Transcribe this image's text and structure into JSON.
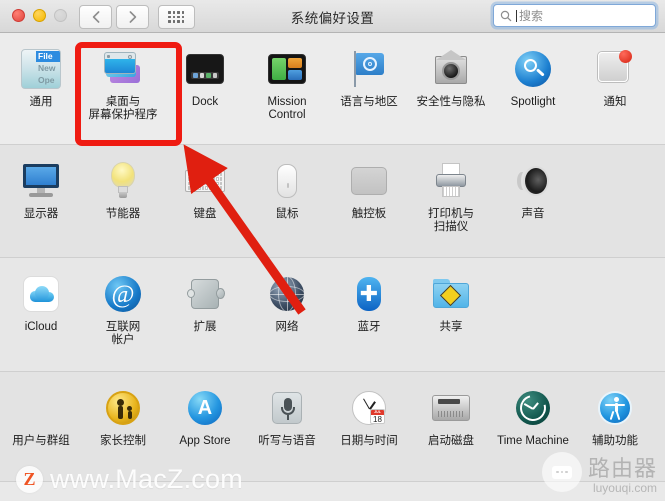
{
  "window": {
    "title": "系统偏好设置",
    "traffic_lights": [
      "close",
      "minimize",
      "zoom"
    ],
    "nav": {
      "back_label": "‹",
      "forward_label": "›",
      "grid_label": "show-all"
    },
    "search": {
      "placeholder": "搜索",
      "value": "",
      "icon": "search-icon"
    }
  },
  "rows": [
    {
      "id": "row-personal",
      "items": [
        {
          "label": "通用",
          "icon": "general-icon"
        },
        {
          "label": "桌面与\n屏幕保护程序",
          "icon": "desktop-screensaver-icon",
          "highlighted": true
        },
        {
          "label": "Dock",
          "icon": "dock-icon"
        },
        {
          "label": "Mission\nControl",
          "icon": "mission-control-icon"
        },
        {
          "label": "语言与地区",
          "icon": "language-region-icon"
        },
        {
          "label": "安全性与隐私",
          "icon": "security-privacy-icon"
        },
        {
          "label": "Spotlight",
          "icon": "spotlight-icon"
        },
        {
          "label": "通知",
          "icon": "notifications-icon"
        }
      ]
    },
    {
      "id": "row-hardware",
      "items": [
        {
          "label": "显示器",
          "icon": "displays-icon"
        },
        {
          "label": "节能器",
          "icon": "energy-saver-icon"
        },
        {
          "label": "键盘",
          "icon": "keyboard-icon"
        },
        {
          "label": "鼠标",
          "icon": "mouse-icon"
        },
        {
          "label": "触控板",
          "icon": "trackpad-icon"
        },
        {
          "label": "打印机与\n扫描仪",
          "icon": "printers-scanners-icon"
        },
        {
          "label": "声音",
          "icon": "sound-icon"
        }
      ]
    },
    {
      "id": "row-internet",
      "items": [
        {
          "label": "iCloud",
          "icon": "icloud-icon"
        },
        {
          "label": "互联网\n帐户",
          "icon": "internet-accounts-icon"
        },
        {
          "label": "扩展",
          "icon": "extensions-icon"
        },
        {
          "label": "网络",
          "icon": "network-icon"
        },
        {
          "label": "蓝牙",
          "icon": "bluetooth-icon"
        },
        {
          "label": "共享",
          "icon": "sharing-icon"
        }
      ]
    },
    {
      "id": "row-system",
      "items": [
        {
          "label": "用户与群组",
          "icon": "users-groups-icon"
        },
        {
          "label": "家长控制",
          "icon": "parental-controls-icon"
        },
        {
          "label": "App Store",
          "icon": "app-store-icon"
        },
        {
          "label": "听写与语音",
          "icon": "dictation-speech-icon"
        },
        {
          "label": "日期与时间",
          "icon": "date-time-icon"
        },
        {
          "label": "启动磁盘",
          "icon": "startup-disk-icon"
        },
        {
          "label": "Time Machine",
          "icon": "time-machine-icon"
        },
        {
          "label": "辅助功能",
          "icon": "accessibility-icon"
        }
      ]
    }
  ],
  "annotations": {
    "highlight_color": "#ef1b12",
    "highlight_target": "桌面与屏幕保护程序",
    "arrow_color": "#e01f10",
    "arrow_from": "网络",
    "arrow_to": "桌面与屏幕保护程序"
  },
  "watermarks": {
    "primary": {
      "badge": "Z",
      "text": "www.MacZ.com"
    },
    "secondary": {
      "cn": "路由器",
      "en": "luyouqi.com"
    }
  },
  "icon_details": {
    "general_menu": {
      "selected": "File",
      "item2": "New",
      "item3": "Ope"
    },
    "date_time_calendar": {
      "month": "JUL",
      "day": "18"
    },
    "app_store_glyph": "A",
    "bluetooth_glyph": "✚",
    "internet_accounts_glyph": "@"
  }
}
